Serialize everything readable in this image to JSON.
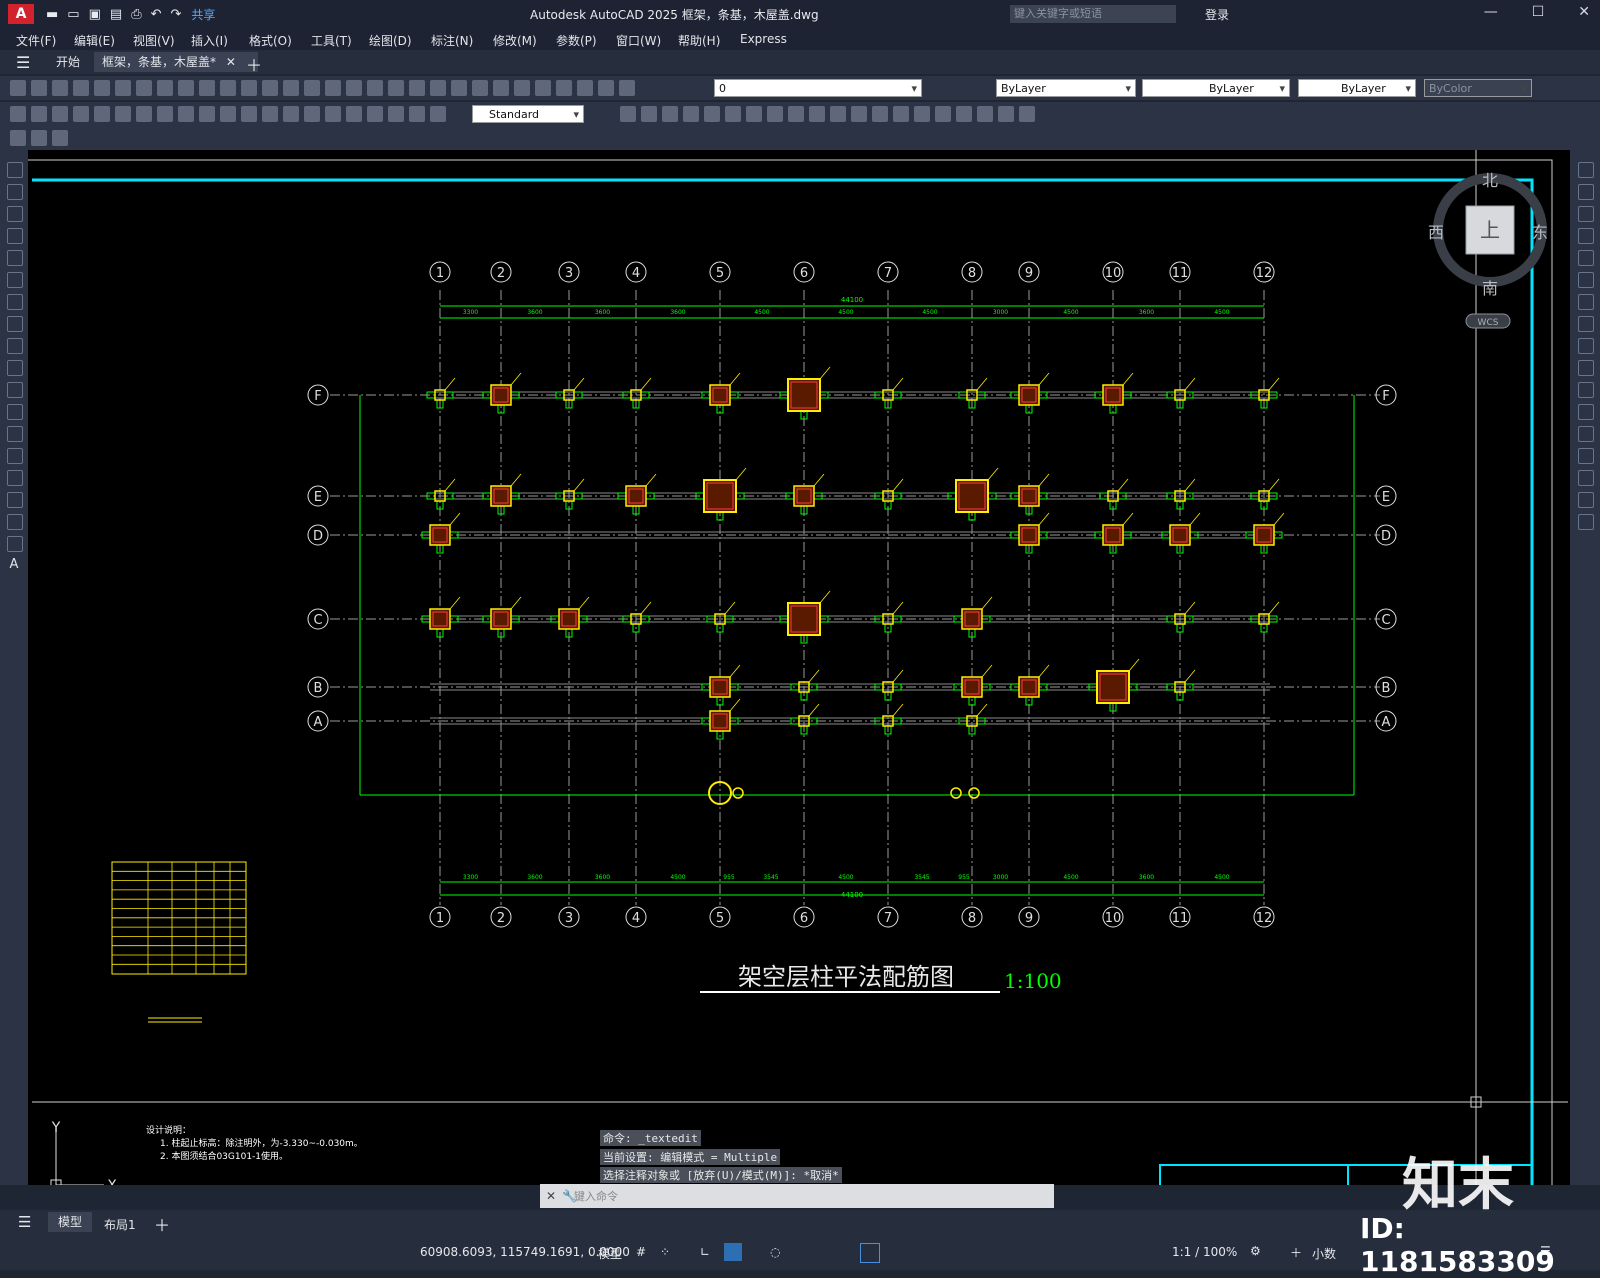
{
  "app": {
    "title": "Autodesk AutoCAD 2025    框架，条基，木屋盖.dwg",
    "logo": "A",
    "share": "共享",
    "search_placeholder": "键入关键字或短语",
    "login": "登录"
  },
  "menu": [
    "文件(F)",
    "编辑(E)",
    "视图(V)",
    "插入(I)",
    "格式(O)",
    "工具(T)",
    "绘图(D)",
    "标注(N)",
    "修改(M)",
    "参数(P)",
    "窗口(W)",
    "帮助(H)",
    "Express"
  ],
  "tabs": {
    "start": "开始",
    "doc": "框架，条基，木屋盖*"
  },
  "properties": {
    "layer": "0",
    "color": "ByLayer",
    "linetype": "ByLayer",
    "lineweight": "ByLayer",
    "plotstyle": "ByColor",
    "textstyle": "Standard"
  },
  "viewcube": {
    "north": "北",
    "south": "南",
    "east": "东",
    "west": "西",
    "top": "上",
    "wcs": "WCS"
  },
  "drawing": {
    "title": "架空层柱平法配筋图",
    "scale": "1:100",
    "axes_numbers": [
      "1",
      "2",
      "3",
      "4",
      "5",
      "6",
      "7",
      "8",
      "9",
      "10",
      "11",
      "12"
    ],
    "axes_letters": [
      "F",
      "E",
      "D",
      "C",
      "B",
      "A"
    ],
    "top_dims": [
      "3300",
      "3600",
      "3600",
      "3600",
      "4500",
      "4500",
      "4500",
      "3000",
      "4500",
      "3600",
      "4500"
    ],
    "bottom_dims": [
      "3300",
      "3600",
      "3600",
      "4500",
      "955",
      "3545",
      "4500",
      "3545",
      "955",
      "3000",
      "4500",
      "3600",
      "4500"
    ],
    "overall": "44100",
    "notes_title": "设计说明：",
    "notes": [
      "1. 柱起止标高：除注明外，为-3.330~-0.030m。",
      "2. 本图须结合03G101-1使用。"
    ]
  },
  "command": {
    "history": [
      "命令: _textedit",
      "当前设置: 编辑模式 = Multiple",
      "选择注释对象或 [放弃(U)/模式(M)]: *取消*"
    ],
    "placeholder": "键入命令"
  },
  "layouts": {
    "model": "模型",
    "layout1": "布局1"
  },
  "status": {
    "coords": "60908.6093, 115749.1691, 0.0000",
    "model": "模型",
    "scale": "1:1 / 100%",
    "units": "小数"
  },
  "watermark": {
    "brand": "知末",
    "id": "ID: 1181583309"
  }
}
